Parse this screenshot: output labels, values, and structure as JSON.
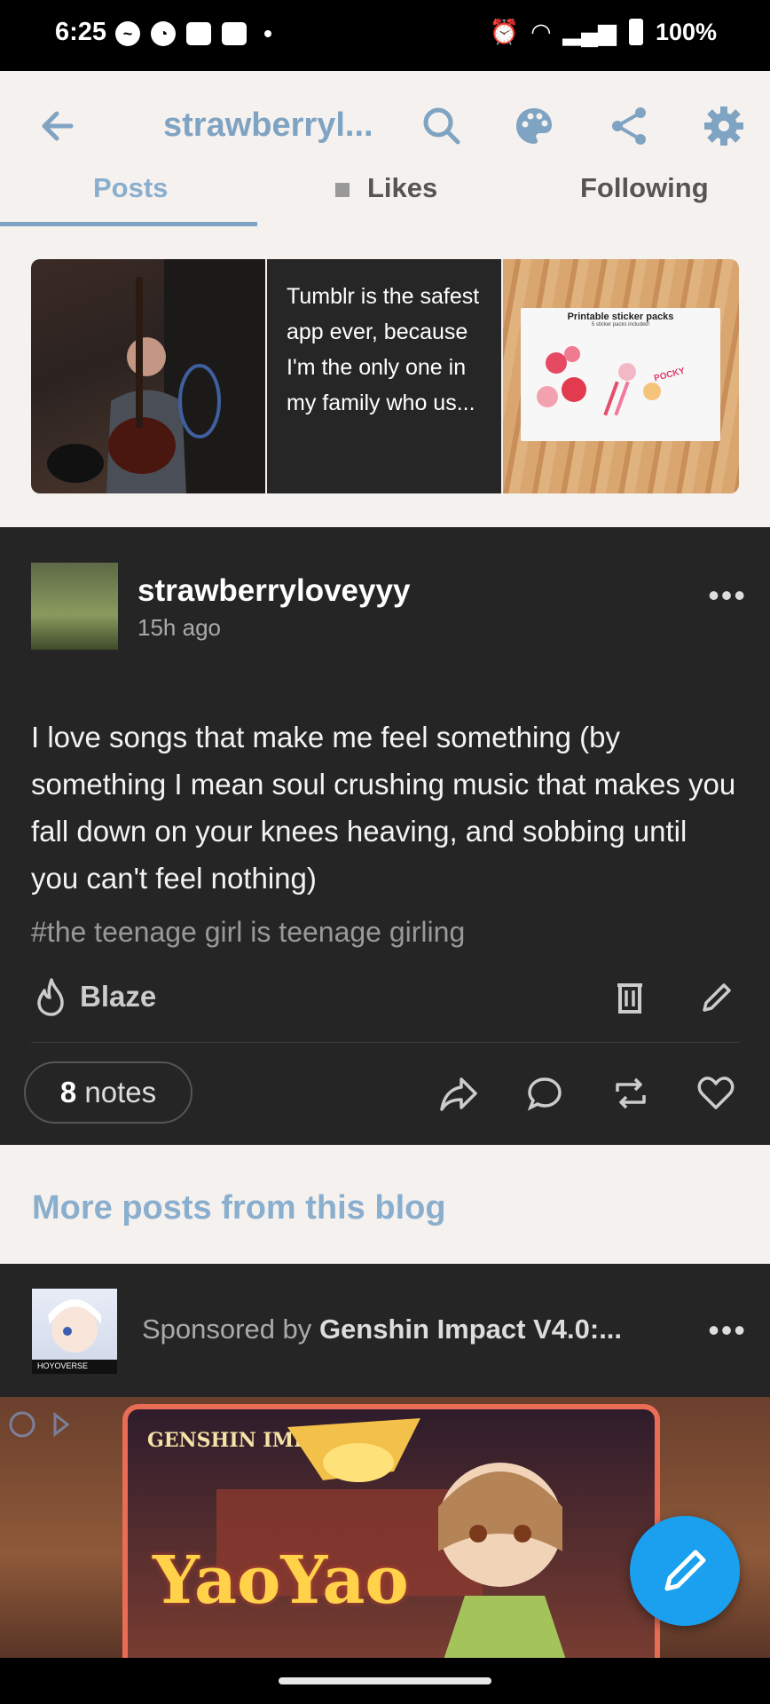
{
  "status_bar": {
    "time": "6:25",
    "battery": "100%"
  },
  "header": {
    "title": "strawberryl...",
    "back_icon": "arrow-left-icon",
    "icons": [
      "search-icon",
      "palette-icon",
      "share-icon",
      "gear-icon"
    ],
    "accent_color": "#7fa3c2"
  },
  "tabs": [
    {
      "label": "Posts",
      "active": true
    },
    {
      "label": "Likes",
      "active": false
    },
    {
      "label": "Following",
      "active": false
    }
  ],
  "grid": {
    "tile_text": "Tumblr is the safest app ever, because I'm the only one in my family who us...",
    "sticker_title": "Printable sticker packs",
    "sticker_subtitle": "5 sticker packs included!",
    "sticker_label": "POCKY"
  },
  "post": {
    "username": "strawberryloveyyy",
    "time_ago": "15h ago",
    "body": "I love songs that make me feel something (by something I mean soul crushing music that makes you fall down on your knees heaving, and sobbing until you can't feel nothing)",
    "tag": "#the teenage girl is teenage girling",
    "blaze_label": "Blaze",
    "notes_count": "8",
    "notes_label": "notes"
  },
  "more_posts": {
    "title": "More posts from this blog"
  },
  "sponsored": {
    "prefix": "Sponsored by",
    "advertiser": "Genshin Impact V4.0:...",
    "avatar_caption": "HOYOVERSE"
  },
  "ad": {
    "brand": "GENSHIN IMPACT",
    "headline": "YaoYao"
  },
  "colors": {
    "background_light": "#f5f1ee",
    "card_dark": "#252525",
    "fab": "#1aa0ef"
  }
}
